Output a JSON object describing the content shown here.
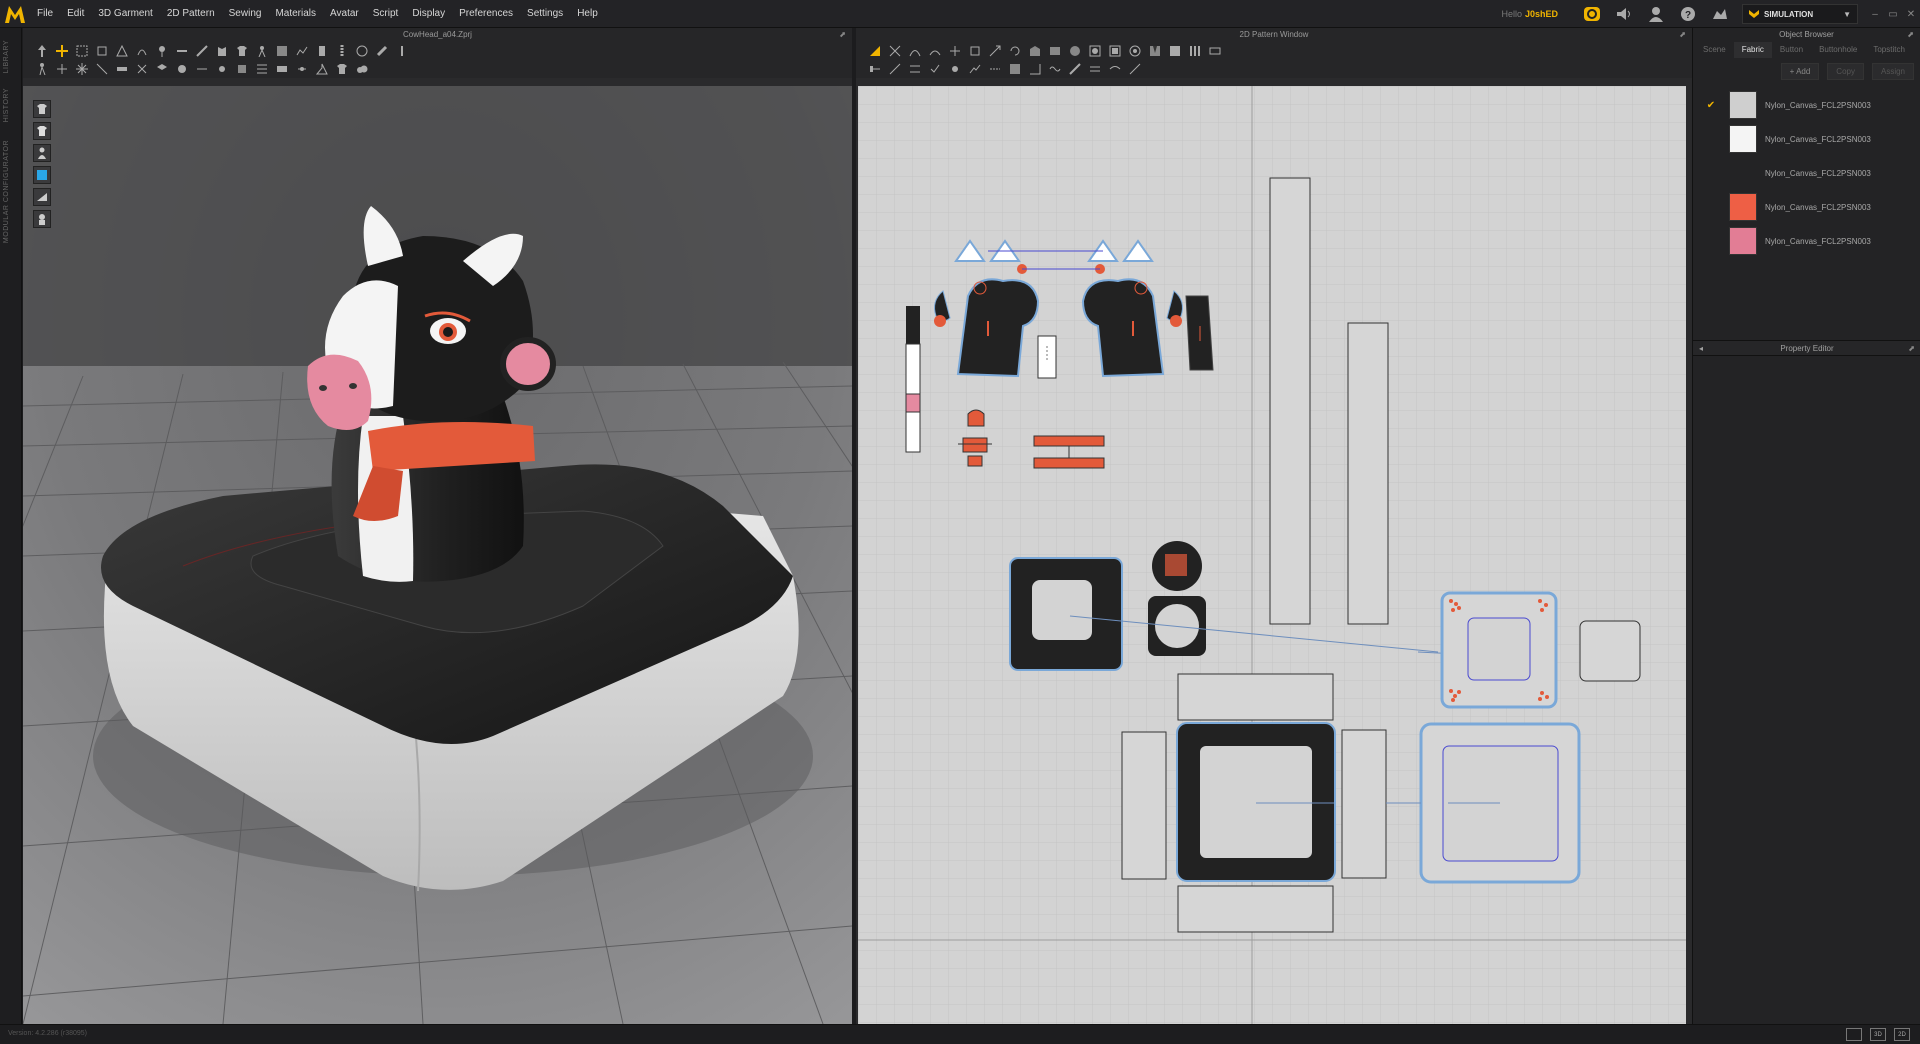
{
  "app": {
    "logo_letter": "M",
    "brand_color": "#f0b400"
  },
  "menu": [
    "File",
    "Edit",
    "3D Garment",
    "2D Pattern",
    "Sewing",
    "Materials",
    "Avatar",
    "Script",
    "Display",
    "Preferences",
    "Settings",
    "Help"
  ],
  "user": {
    "hello": "Hello",
    "name": "J0shED"
  },
  "simulation": {
    "label": "SIMULATION"
  },
  "left_tabs": [
    "LIBRARY",
    "HISTORY",
    "MODULAR CONFIGURATOR"
  ],
  "window_3d": {
    "title": "CowHead_a04.Zprj"
  },
  "window_2d": {
    "title": "2D Pattern Window"
  },
  "object_browser": {
    "title": "Object Browser",
    "tabs": [
      "Scene",
      "Fabric",
      "Button",
      "Buttonhole",
      "Topstitch"
    ],
    "active_tab": "Fabric",
    "add_label": "+ Add",
    "copy_label": "Copy",
    "assign_label": "Assign",
    "fabrics": [
      {
        "name": "Nylon_Canvas_FCL2PSN003",
        "color": "#cfcfcf",
        "checked": true
      },
      {
        "name": "Nylon_Canvas_FCL2PSN003",
        "color": "#f4f4f4",
        "checked": false
      },
      {
        "name": "Nylon_Canvas_FCL2PSN003",
        "color": "#232325",
        "checked": false
      },
      {
        "name": "Nylon_Canvas_FCL2PSN003",
        "color": "#ee5f45",
        "checked": false
      },
      {
        "name": "Nylon_Canvas_FCL2PSN003",
        "color": "#e27d95",
        "checked": false
      }
    ]
  },
  "property_editor": {
    "title": "Property Editor"
  },
  "status": {
    "version": "Version: 4.2.286 (r38095)"
  }
}
